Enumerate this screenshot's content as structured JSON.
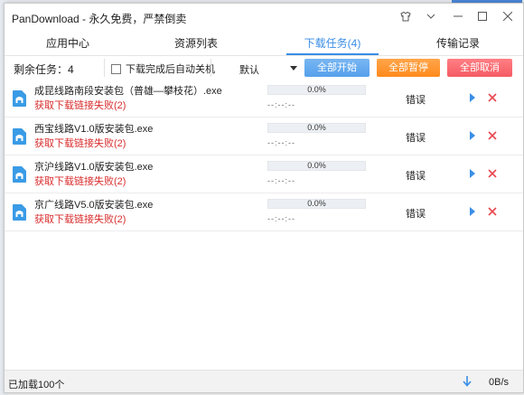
{
  "window": {
    "title": "PanDownload - 永久免费，严禁倒卖"
  },
  "tabs": [
    {
      "label": "应用中心",
      "active": false
    },
    {
      "label": "资源列表",
      "active": false
    },
    {
      "label": "下载任务(4)",
      "active": true
    },
    {
      "label": "传输记录",
      "active": false
    }
  ],
  "toolbar": {
    "remaining": "剩余任务：4",
    "auto_shutdown_label": "下载完成后自动关机",
    "auto_shutdown_checked": false,
    "priority_select": "默认",
    "start_all": "全部开始",
    "pause_all": "全部暂停",
    "cancel_all": "全部取消"
  },
  "downloads": [
    {
      "filename": "成昆线路南段安装包（普雄—攀枝花）.exe",
      "error": "获取下载链接失败(2)",
      "progress": "0.0%",
      "progress_value": 0,
      "time": "--:--:--",
      "status": "错误"
    },
    {
      "filename": "西宝线路V1.0版安装包.exe",
      "error": "获取下载链接失败(2)",
      "progress": "0.0%",
      "progress_value": 0,
      "time": "--:--:--",
      "status": "错误"
    },
    {
      "filename": "京沪线路V1.0版安装包.exe",
      "error": "获取下载链接失败(2)",
      "progress": "0.0%",
      "progress_value": 0,
      "time": "--:--:--",
      "status": "错误"
    },
    {
      "filename": "京广线路V5.0版安装包.exe",
      "error": "获取下载链接失败(2)",
      "progress": "0.0%",
      "progress_value": 0,
      "time": "--:--:--",
      "status": "错误"
    }
  ],
  "statusbar": {
    "loaded": "已加载100个",
    "speed": "0B/s"
  },
  "colors": {
    "accent": "#3a8ee6",
    "error": "#d92d2d",
    "start": "#55a0ec",
    "pause": "#ff8a1c",
    "cancel": "#f55b63"
  },
  "icons": [
    "skin-icon",
    "dropdown-icon",
    "minimize-icon",
    "maximize-icon",
    "close-icon",
    "file-icon",
    "play-icon",
    "delete-icon",
    "download-arrow-icon"
  ]
}
